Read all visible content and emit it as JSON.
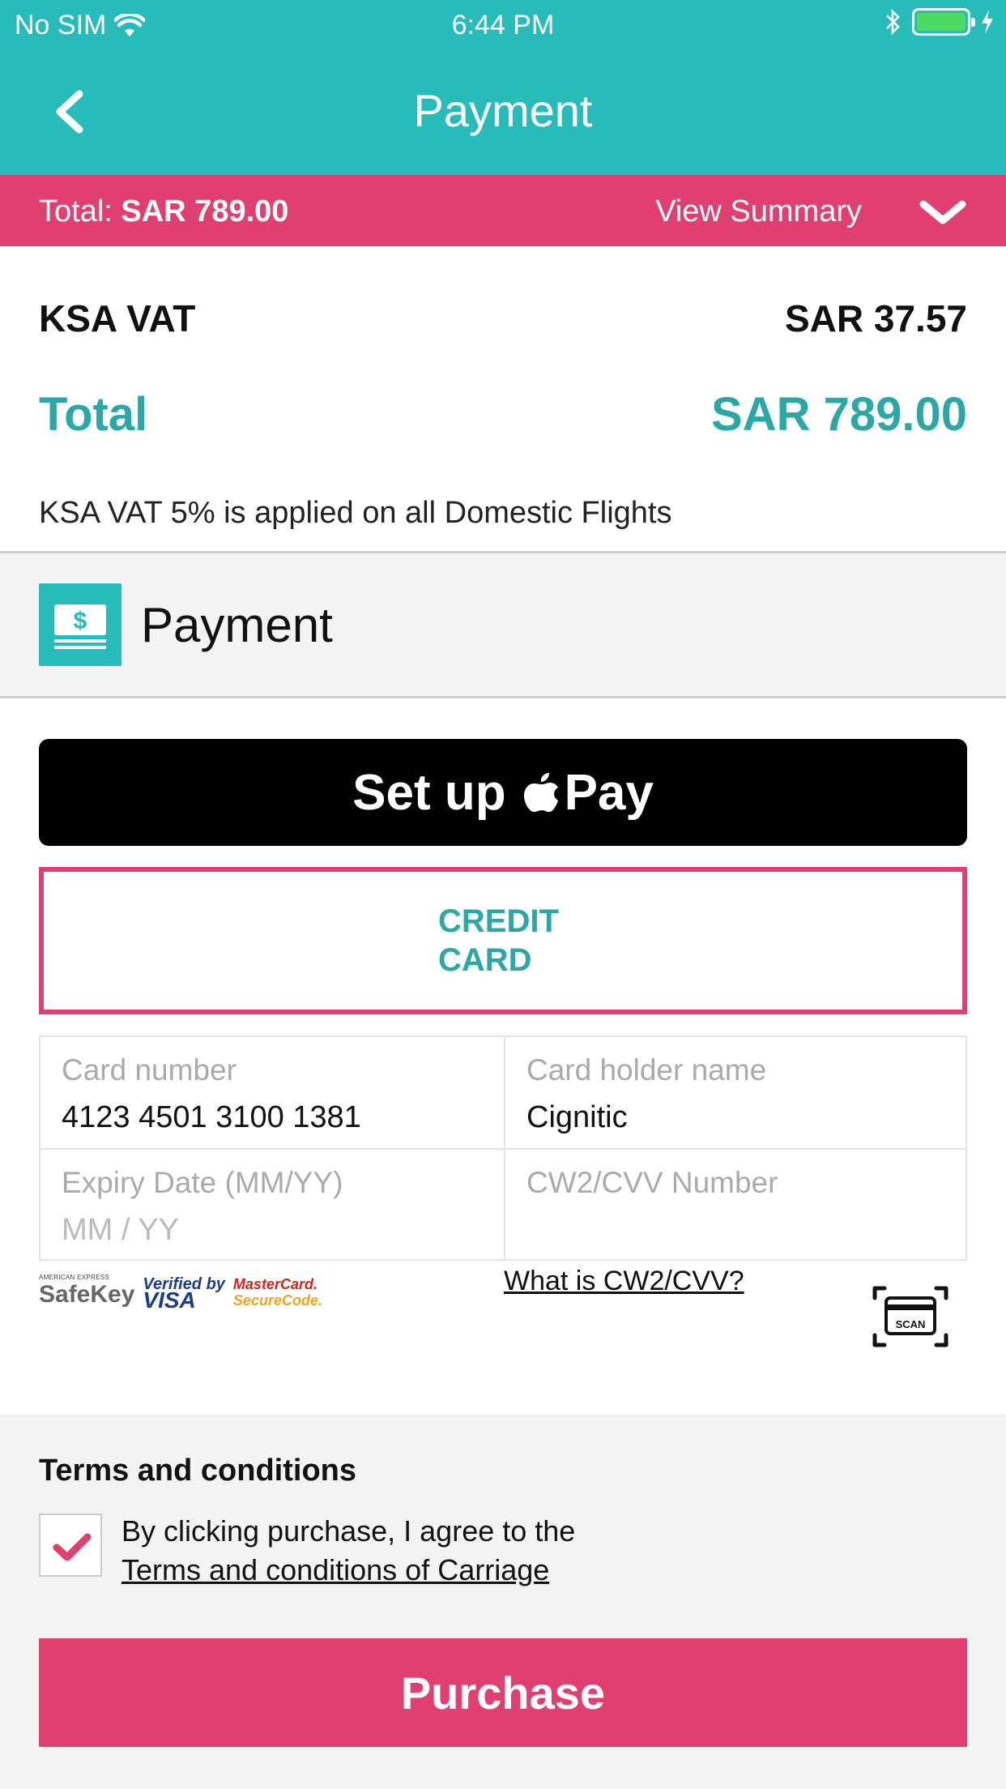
{
  "status_bar": {
    "carrier": "No SIM",
    "time": "6:44 PM"
  },
  "nav": {
    "title": "Payment"
  },
  "summary_bar": {
    "total_label": "Total:",
    "total_value": "SAR 789.00",
    "view_summary": "View Summary"
  },
  "breakdown": {
    "vat_label": "KSA VAT",
    "vat_value": "SAR 37.57",
    "total_label": "Total",
    "total_value": "SAR 789.00",
    "note": "KSA VAT 5% is applied on all Domestic Flights"
  },
  "payment_section": {
    "title": "Payment",
    "icon_symbol": "$"
  },
  "apple_pay": {
    "prefix": "Set up",
    "suffix": "Pay"
  },
  "credit_card_button": {
    "label": "CREDIT CARD"
  },
  "card_form": {
    "card_number_label": "Card number",
    "card_number_value": "4123 4501 3100 1381",
    "holder_label": "Card holder name",
    "holder_value": "Cignitic",
    "expiry_label": "Expiry Date (MM/YY)",
    "expiry_placeholder": "MM / YY",
    "cvv_label": "CW2/CVV Number",
    "cvv_value": ""
  },
  "badges": {
    "safekey_top": "AMERICAN EXPRESS",
    "safekey_main": "SafeKey",
    "visa_top": "Verified by",
    "visa_main": "VISA",
    "mc_top": "MasterCard.",
    "mc_main": "SecureCode."
  },
  "cvv_link": "What is CW2/CVV?",
  "scan_label": "SCAN",
  "terms": {
    "title": "Terms and conditions",
    "text": "By clicking purchase, I agree to the",
    "link": "Terms and conditions of Carriage",
    "checked": true
  },
  "purchase_button": "Purchase",
  "colors": {
    "teal": "#27bcba",
    "pink": "#e03f6f",
    "teal_text": "#2aa8a6"
  }
}
